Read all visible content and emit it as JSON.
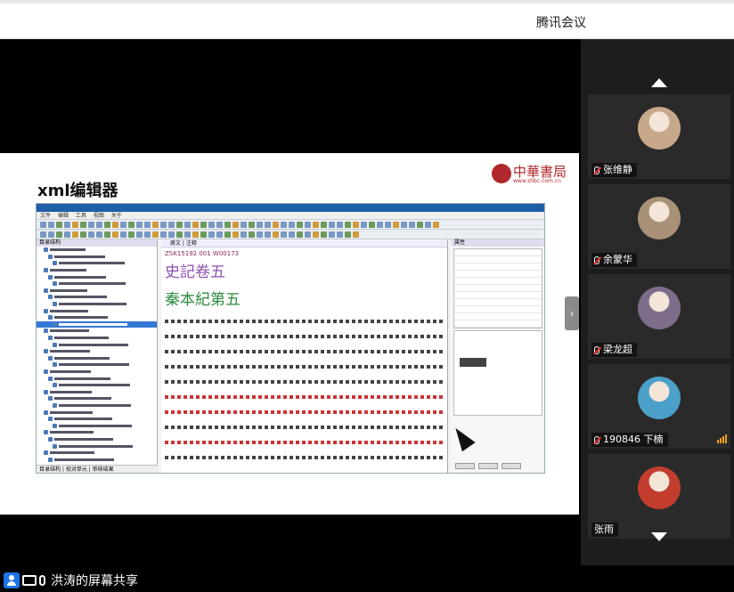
{
  "app": {
    "title": "腾讯会议"
  },
  "slide": {
    "title": "xml编辑器",
    "logo": {
      "brand": "中華書局",
      "url": "www.zhbc.com.cn"
    },
    "editor": {
      "menu": [
        "文件",
        "编辑",
        "工具",
        "视图",
        "关于"
      ],
      "tree_header": "目录结构",
      "tree_tabs": "目录结构 | 校对单元 | 审核结果",
      "doc_tabs": "原文 | 注释",
      "doc_id": "ZSK15192 001 W00173",
      "heading1": "史記卷五",
      "heading2": "秦本紀第五",
      "props_header": "属性"
    }
  },
  "participants": [
    {
      "name": "张维静",
      "muted": true,
      "avatar_color": "#c7a88a"
    },
    {
      "name": "余蒙华",
      "muted": true,
      "avatar_color": "#a89176"
    },
    {
      "name": "梁龙超",
      "muted": true,
      "avatar_color": "#7d6d8a"
    },
    {
      "name": "190846 下楠",
      "muted": true,
      "avatar_color": "#4aa0c8",
      "speaking": true
    },
    {
      "name": "张雨",
      "muted": false,
      "avatar_color": "#c23d2e"
    }
  ],
  "footer": {
    "status": "洪涛的屏幕共享"
  },
  "icons": {
    "side_toggle": "chevron-right-icon",
    "scroll_up": "arrow-up-icon",
    "scroll_down": "arrow-down-icon",
    "user": "user-icon",
    "screen": "screen-share-icon",
    "mic": "microphone-icon"
  }
}
